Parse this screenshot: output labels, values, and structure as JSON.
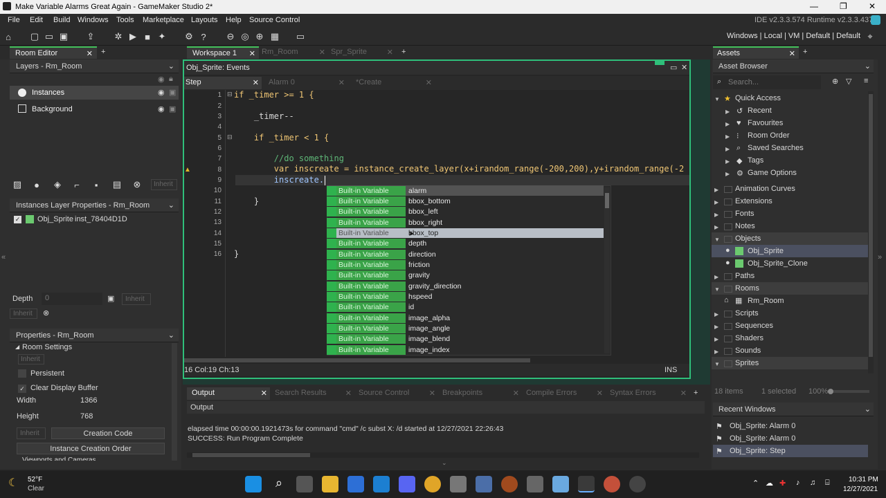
{
  "window": {
    "title": "Make Variable Alarms Great Again - GameMaker Studio 2*"
  },
  "menu": [
    "File",
    "Edit",
    "Build",
    "Windows",
    "Tools",
    "Marketplace",
    "Layouts",
    "Help",
    "Source Control"
  ],
  "ide_version": "IDE v2.3.3.574  Runtime v2.3.3.437",
  "targets": "Windows | Local | VM | Default | Default",
  "room_editor": {
    "tab": "Room Editor",
    "layers_header": "Layers - Rm_Room",
    "layers": [
      "Instances",
      "Background"
    ],
    "inherit": "Inherit",
    "instances_header": "Instances Layer Properties - Rm_Room",
    "instance": {
      "object": "Obj_Sprite",
      "id": "inst_78404D1D"
    },
    "depth_label": "Depth",
    "depth_value": "0",
    "properties_header": "Properties - Rm_Room",
    "room_settings": "Room Settings",
    "persistent": "Persistent",
    "clear_display": "Clear Display Buffer",
    "width_label": "Width",
    "width_value": "1366",
    "height_label": "Height",
    "height_value": "768",
    "creation_code": "Creation Code",
    "creation_order": "Instance Creation Order",
    "viewports": "Viewports and Cameras"
  },
  "workspace_tabs": [
    "Workspace 1",
    "Rm_Room",
    "Spr_Sprite"
  ],
  "events_window": {
    "title": "Obj_Sprite: Events",
    "tabs": [
      "Step",
      "Alarm 0",
      "*Create"
    ]
  },
  "code_lines": [
    {
      "n": "1",
      "text": "if _timer >= 1 {"
    },
    {
      "n": "2",
      "text": ""
    },
    {
      "n": "3",
      "text": "    _timer--"
    },
    {
      "n": "4",
      "text": ""
    },
    {
      "n": "5",
      "text": "    if _timer < 1 {"
    },
    {
      "n": "6",
      "text": ""
    },
    {
      "n": "7",
      "text": "        //do something"
    },
    {
      "n": "8",
      "text": "        var inscreate = instance_create_layer(x+irandom_range(-200,200),y+irandom_range(-2"
    },
    {
      "n": "9",
      "text": "        inscreate."
    },
    {
      "n": "10",
      "text": ""
    },
    {
      "n": "11",
      "text": "    }"
    },
    {
      "n": "12",
      "text": ""
    },
    {
      "n": "13",
      "text": ""
    },
    {
      "n": "14",
      "text": ""
    },
    {
      "n": "15",
      "text": ""
    },
    {
      "n": "16",
      "text": "}"
    }
  ],
  "autocomplete": {
    "kind": "Built-in Variable",
    "items": [
      "alarm",
      "bbox_bottom",
      "bbox_left",
      "bbox_right",
      "bbox_top",
      "depth",
      "direction",
      "friction",
      "gravity",
      "gravity_direction",
      "hspeed",
      "id",
      "image_alpha",
      "image_angle",
      "image_blend",
      "image_index"
    ]
  },
  "status": {
    "position": "16 Col:19 Ch:13",
    "mode": "INS"
  },
  "output": {
    "tabs": [
      "Output",
      "Search Results",
      "Source Control",
      "Breakpoints",
      "Compile Errors",
      "Syntax Errors"
    ],
    "header": "Output",
    "lines": [
      "elapsed time 00:00:00.1921473s for command \"cmd\" /c subst X: /d started at 12/27/2021 22:26:43",
      "SUCCESS: Run Program Complete"
    ]
  },
  "assets": {
    "tab": "Assets",
    "header": "Asset Browser",
    "search_placeholder": "Search...",
    "quick_access": "Quick Access",
    "quick_items": [
      "Recent",
      "Favourites",
      "Room Order",
      "Saved Searches",
      "Tags",
      "Game Options"
    ],
    "groups": [
      "Animation Curves",
      "Extensions",
      "Fonts",
      "Notes",
      "Objects"
    ],
    "objects": [
      "Obj_Sprite",
      "Obj_Sprite_Clone"
    ],
    "groups2": [
      "Paths",
      "Rooms"
    ],
    "rooms": [
      "Rm_Room"
    ],
    "groups3": [
      "Scripts",
      "Sequences",
      "Shaders",
      "Sounds",
      "Sprites"
    ],
    "items_count": "18 items",
    "selected": "1 selected",
    "zoom": "100%",
    "recent_header": "Recent Windows",
    "recent": [
      "Obj_Sprite: Alarm 0",
      "Obj_Sprite: Alarm 0",
      "Obj_Sprite: Step"
    ]
  },
  "taskbar": {
    "weather_temp": "52°F",
    "weather_desc": "Clear",
    "time": "10:31 PM",
    "date": "12/27/2021"
  }
}
